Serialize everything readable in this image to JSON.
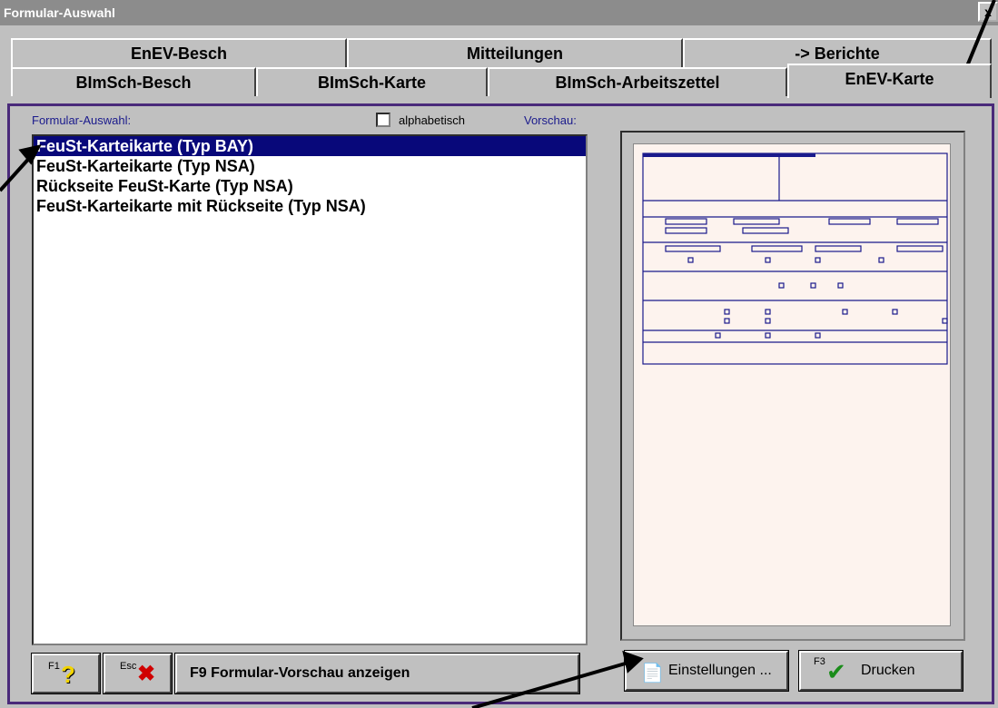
{
  "window": {
    "title": "Formular-Auswahl",
    "close_label": "x"
  },
  "tabs_row1": [
    "EnEV-Besch",
    "Mitteilungen",
    "-> Berichte"
  ],
  "tabs_row2": [
    "BImSch-Besch",
    "BImSch-Karte",
    "BImSch-Arbeitszettel",
    "EnEV-Karte"
  ],
  "active_tab": "EnEV-Karte",
  "form_list": {
    "label": "Formular-Auswahl:",
    "items": [
      "FeuSt-Karteikarte (Typ BAY)",
      "FeuSt-Karteikarte (Typ NSA)",
      "Rückseite FeuSt-Karte (Typ NSA)",
      "FeuSt-Karteikarte mit Rückseite (Typ NSA)"
    ],
    "selected_index": 0
  },
  "alphabetical": {
    "label": "alphabetisch",
    "checked": false
  },
  "preview": {
    "label": "Vorschau:"
  },
  "buttons": {
    "help_key": "F1",
    "help_glyph": "?",
    "esc_key": "Esc",
    "esc_glyph": "✖",
    "preview_label": "F9  Formular-Vorschau anzeigen",
    "settings_label": "Einstellungen ...",
    "print_key": "F3",
    "print_glyph": "✔",
    "print_label": "Drucken"
  },
  "colors": {
    "selection": "#08087a",
    "panel_border": "#4a2a7a",
    "label_text": "#1a1a8c",
    "help_icon": "#f2d400",
    "esc_icon": "#d00000",
    "check_icon": "#1a8c1a",
    "paper": "#fdf3ee"
  }
}
